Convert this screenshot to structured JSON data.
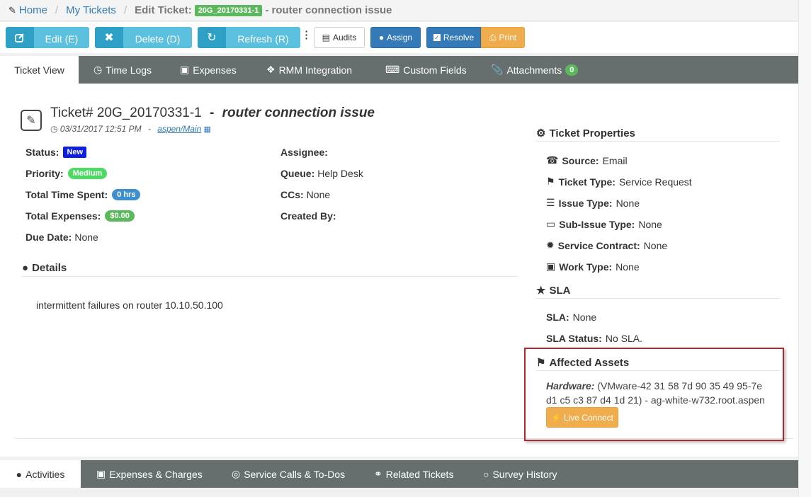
{
  "breadcrumb": {
    "home": "Home",
    "my_tickets": "My Tickets",
    "edit_label": "Edit Ticket:",
    "ticket_badge": "20G_20170331-1",
    "title": "- router connection issue"
  },
  "toolbar": {
    "edit": "Edit (E)",
    "delete": "Delete (D)",
    "refresh": "Refresh (R)",
    "audits": "Audits",
    "assign": "Assign",
    "resolve": "Resolve",
    "print": "Print"
  },
  "tabs": [
    "Ticket View",
    "Time Logs",
    "Expenses",
    "RMM Integration",
    "Custom Fields",
    "Attachments"
  ],
  "attachments_count": "0",
  "ticket": {
    "number_label": "Ticket# 20G_20170331-1",
    "dash": "-",
    "subject": "router connection issue",
    "date": "03/31/2017 12:51 PM",
    "meta_sep": "-",
    "location": "aspen/Main"
  },
  "fields": {
    "status_label": "Status:",
    "status_value": "New",
    "priority_label": "Priority:",
    "priority_value": "Medium",
    "time_label": "Total Time Spent:",
    "time_value": "0 hrs",
    "expenses_label": "Total Expenses:",
    "expenses_value": "$0.00",
    "due_label": "Due Date:",
    "due_value": "None",
    "assignee_label": "Assignee:",
    "queue_label": "Queue:",
    "queue_value": "Help Desk",
    "ccs_label": "CCs:",
    "ccs_value": "None",
    "created_label": "Created By:"
  },
  "details": {
    "heading": "Details",
    "text": "intermittent failures on router 10.10.50.100"
  },
  "properties": {
    "heading": "Ticket Properties",
    "source_label": "Source:",
    "source_value": "Email",
    "type_label": "Ticket Type:",
    "type_value": "Service Request",
    "issue_label": "Issue Type:",
    "issue_value": "None",
    "subissue_label": "Sub-Issue Type:",
    "subissue_value": "None",
    "contract_label": "Service Contract:",
    "contract_value": "None",
    "work_label": "Work Type:",
    "work_value": "None"
  },
  "sla": {
    "heading": "SLA",
    "sla_label": "SLA:",
    "sla_value": "None",
    "status_label": "SLA Status:",
    "status_value": "No SLA."
  },
  "assets": {
    "heading": "Affected Assets",
    "hw_label": "Hardware:",
    "hw_line1": "(VMware-42 31 58 7d 90 35 49 95-7e",
    "hw_line2": "d1 c5 c3 87 d4 1d 21) - ag-white-w732.root.aspen",
    "live_connect": "Live Connect"
  },
  "bottom_tabs": [
    "Activities",
    "Expenses & Charges",
    "Service Calls & To-Dos",
    "Related Tickets",
    "Survey History"
  ],
  "colors": {
    "primary": "#337ab7",
    "info": "#5bc0de",
    "success": "#5cb85c",
    "warning": "#f0ad4e",
    "tabbar": "#676e6e",
    "highlight": "#b3262c"
  }
}
